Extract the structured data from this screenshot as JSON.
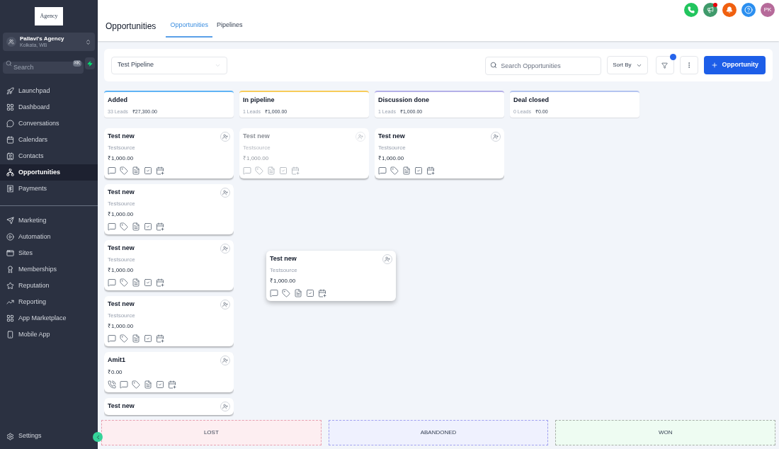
{
  "sidebar": {
    "logo": "Agency",
    "account": {
      "name": "Pallavi's Agency",
      "location": "Kolkata, WB"
    },
    "search": {
      "placeholder": "Search",
      "shortcut": "⌘K"
    },
    "groups": [
      [
        {
          "label": "Launchpad",
          "selected": false
        },
        {
          "label": "Dashboard",
          "selected": false
        },
        {
          "label": "Conversations",
          "selected": false
        },
        {
          "label": "Calendars",
          "selected": false
        },
        {
          "label": "Contacts",
          "selected": false
        },
        {
          "label": "Opportunities",
          "selected": true
        },
        {
          "label": "Payments",
          "selected": false
        }
      ],
      [
        {
          "label": "Marketing",
          "selected": false
        },
        {
          "label": "Automation",
          "selected": false
        },
        {
          "label": "Sites",
          "selected": false
        },
        {
          "label": "Memberships",
          "selected": false
        },
        {
          "label": "Reputation",
          "selected": false
        },
        {
          "label": "Reporting",
          "selected": false
        },
        {
          "label": "App Marketplace",
          "selected": false
        },
        {
          "label": "Mobile App",
          "selected": false
        }
      ]
    ],
    "settings": "Settings"
  },
  "header": {
    "avatar": "PK",
    "megaphone_alert": true
  },
  "title": "Opportunities",
  "tabs": [
    {
      "label": "Opportunities",
      "selected": true
    },
    {
      "label": "Pipelines",
      "selected": false
    }
  ],
  "toolbar": {
    "pipeline": "Test Pipeline",
    "search_placeholder": "Search Opportunities",
    "sort": "Sort By",
    "filter_active": true,
    "add_button": "Opportunity"
  },
  "stages": [
    {
      "name": "Added",
      "leads": "33 Leads",
      "amount": "₹27,300.00",
      "color": "#60b4f5",
      "cards": [
        {
          "title": "Test new",
          "source": "Testsource",
          "amount": "₹1,000.00",
          "call": false,
          "faded": false
        },
        {
          "title": "Test new",
          "source": "Testsource",
          "amount": "₹1,000.00",
          "call": false,
          "faded": false
        },
        {
          "title": "Test new",
          "source": "Testsource",
          "amount": "₹1,000.00",
          "call": false,
          "faded": false
        },
        {
          "title": "Test new",
          "source": "Testsource",
          "amount": "₹1,000.00",
          "call": false,
          "faded": false
        },
        {
          "title": "Amit1",
          "amount": "₹0.00",
          "call": true,
          "faded": false
        },
        {
          "title": "Test new"
        }
      ]
    },
    {
      "name": "In pipeline",
      "leads": "1 Leads",
      "amount": "₹1,000.00",
      "color": "#f8cc5a",
      "cards": [
        {
          "title": "Test new",
          "source": "Testsource",
          "amount": "₹1,000.00",
          "call": false,
          "faded": true
        }
      ]
    },
    {
      "name": "Discussion done",
      "leads": "1 Leads",
      "amount": "₹1,000.00",
      "color": "#b4b0e8",
      "cards": [
        {
          "title": "Test new",
          "source": "Testsource",
          "amount": "₹1,000.00",
          "call": false,
          "faded": false
        }
      ]
    },
    {
      "name": "Deal closed",
      "leads": "0 Leads",
      "amount": "₹0.00",
      "color": "#b4c4f0"
    }
  ],
  "dragged_card": {
    "title": "Test new",
    "source": "Testsource",
    "amount": "₹1,000.00"
  },
  "drop_zones": [
    {
      "label": "LOST",
      "color": "#e8a0b0"
    },
    {
      "label": "ABANDONED",
      "color": "#a0a0f0"
    },
    {
      "label": "WON",
      "color": "#a8b0a8"
    }
  ]
}
